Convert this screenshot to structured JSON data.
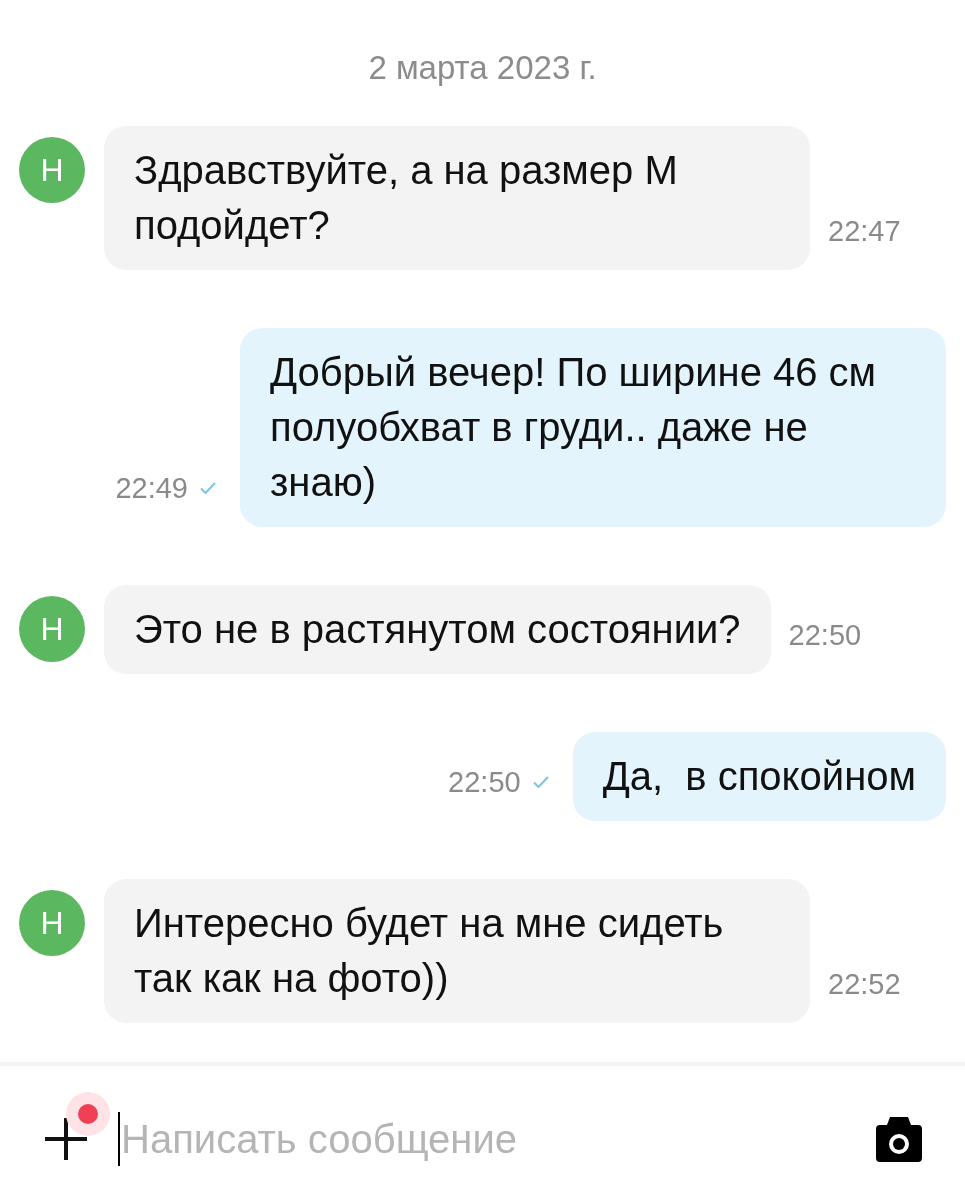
{
  "date_header": "2 марта 2023 г.",
  "messages": [
    {
      "kind": "incoming",
      "avatar": "Н",
      "text": "Здравствуйте, а на размер М подойдет?",
      "time": "22:47"
    },
    {
      "kind": "outgoing",
      "text": "Добрый вечер! По ширине 46 см полуобхват в груди.. даже не знаю)",
      "time": "22:49",
      "delivered": true
    },
    {
      "kind": "incoming",
      "avatar": "Н",
      "text": "Это не в растянутом состоянии?",
      "time": "22:50"
    },
    {
      "kind": "outgoing",
      "text": "Да,  в спокойном",
      "time": "22:50",
      "delivered": true
    },
    {
      "kind": "incoming",
      "avatar": "Н",
      "text": "Интересно будет на мне сидеть так как на фото))",
      "time": "22:52"
    }
  ],
  "composer": {
    "placeholder": "Написать сообщение",
    "attachment_badge": true
  }
}
